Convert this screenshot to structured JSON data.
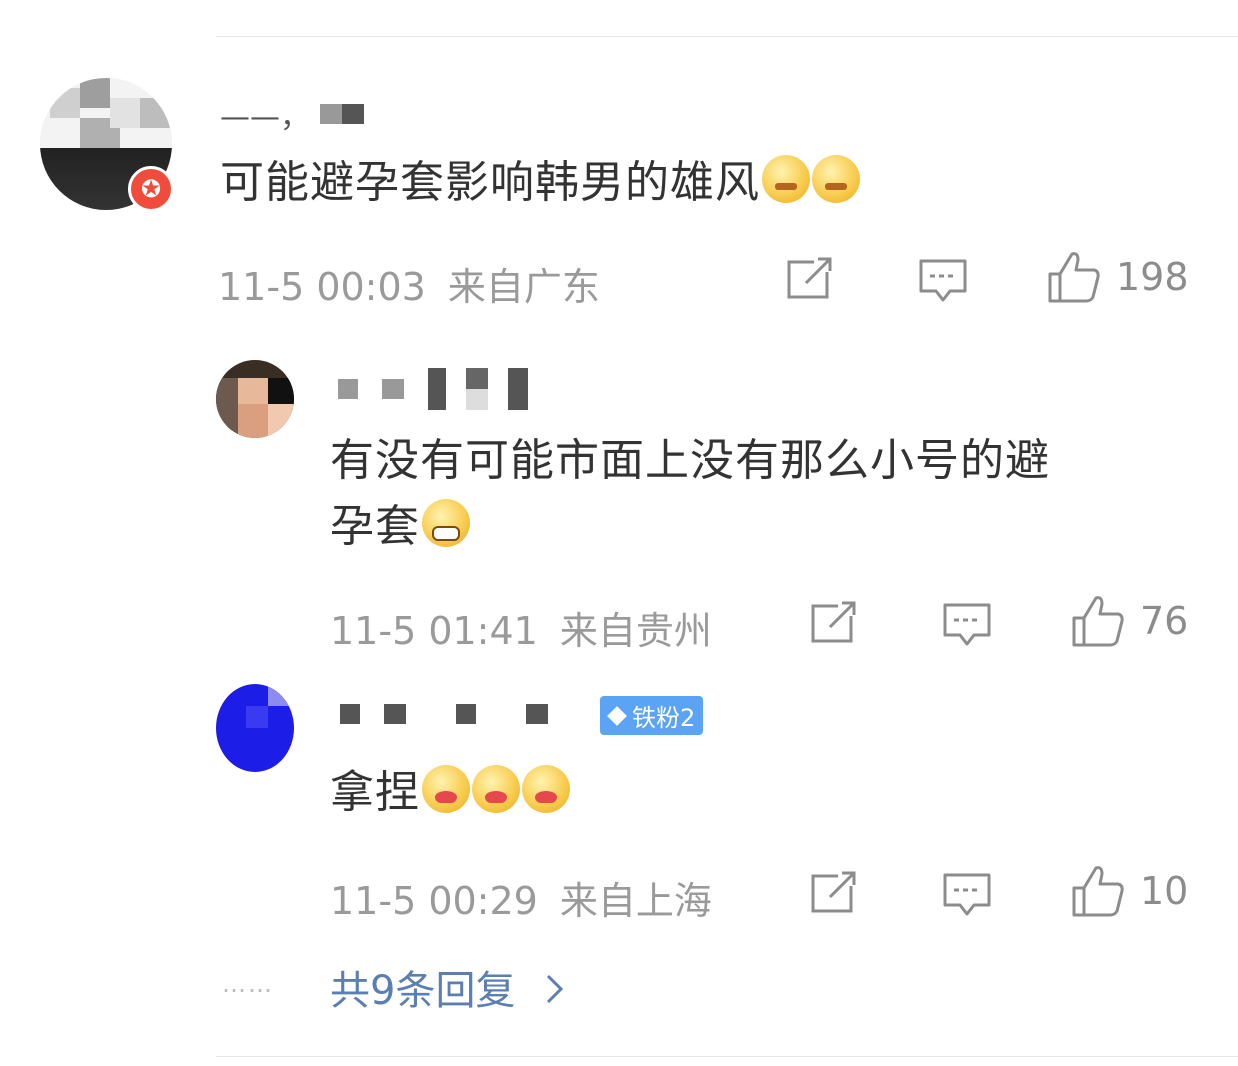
{
  "comments": [
    {
      "username": "——，",
      "text": "可能避孕套影响韩男的雄风",
      "time": "11-5 00:03",
      "location": "来自广东",
      "likes": "198"
    }
  ],
  "replies": [
    {
      "text_line1": "有没有可能市面上没有那么小号的避",
      "text_line2": "孕套",
      "time": "11-5 01:41",
      "location": "来自贵州",
      "likes": "76"
    },
    {
      "badge": "铁粉2",
      "text": "拿捏",
      "time": "11-5 00:29",
      "location": "来自上海",
      "likes": "10"
    }
  ],
  "more_replies": "共9条回复",
  "more_dots": "……",
  "icons": [
    "repost-icon",
    "comment-icon",
    "like-icon",
    "chevron-right-icon",
    "diamond-icon"
  ],
  "colors": {
    "link": "#5b7fb0",
    "badge": "#5aa3f5",
    "meta": "#9a9a9a"
  }
}
